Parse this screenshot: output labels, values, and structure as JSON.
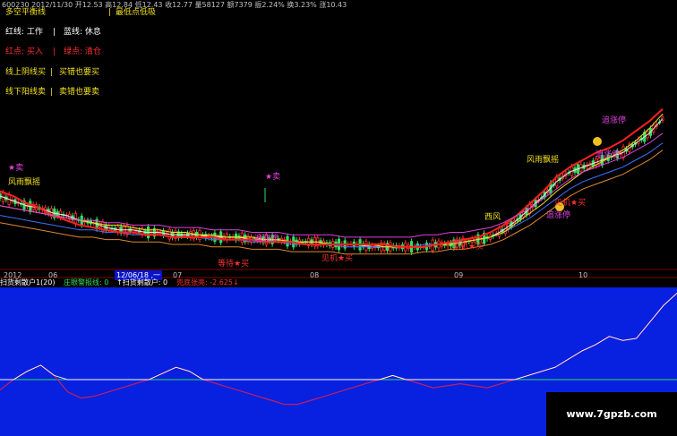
{
  "header": {
    "info_line": "600230  2012/11/30  开12.53  高12.84  低12.43  收12.77  量58127  额7379  振2.24%  换3.23%  涨10.43"
  },
  "top_legend": {
    "row0": [
      "多空平衡线",
      "|",
      "最低点低吸"
    ],
    "row1": [
      "红线: 工作",
      "|",
      "蓝线: 休息"
    ],
    "row2": [
      "红点: 买入",
      "|",
      "绿点: 清仓"
    ],
    "row3": [
      "线上阴线买",
      "|",
      "买错也要买"
    ],
    "row4": [
      "线下阳线卖",
      "|",
      "卖错也要卖"
    ]
  },
  "annotations": {
    "star_sell_1": "★卖",
    "storm_1": "风雨飘摇",
    "star_sell_2": "★卖",
    "chase_limit_1": "追涨停",
    "wait_buy_1": "等待★买",
    "buy_chance_1": "见机★买",
    "buy_chance_2": "见机★买",
    "west_wind": "西风",
    "storm_2": "风雨飘摇",
    "chase_limit_2": "追涨停",
    "chase_limit_3": "追涨停",
    "buy_chance_3": "见机★买",
    "chase_limit_4": "追涨停"
  },
  "time_axis": {
    "labels": [
      "2012",
      "06",
      "12/06/18 ,一",
      "07",
      "08",
      "09",
      "10"
    ]
  },
  "indicator_bar": {
    "title": "扫货剩散户1(20)",
    "line1": "庄眼警报线: 0",
    "line2": "↑扫货剩散户: 0",
    "line3": "兜底张亮: -2.625↓"
  },
  "watermark": "www.7gpzb.com",
  "colors": {
    "background": "#000000",
    "up_candle": "#ff3030",
    "down_candle": "#30e060",
    "ma_white": "#e8e8e8",
    "ma_yellow": "#f0e020",
    "ma_magenta": "#e040e0",
    "ma_red": "#ff2020",
    "ma_orange": "#e08830",
    "ma_blue": "#4070ff",
    "indicator_bg": "#0820e0",
    "indicator_line": "#c02060",
    "indicator_white": "#ffffff",
    "indicator_zero": "#30e060"
  },
  "chart_data": {
    "type": "line",
    "series": [
      {
        "values": [
          60,
          58,
          56,
          55,
          53,
          52,
          50,
          49,
          47,
          46,
          46,
          45,
          45,
          44,
          44,
          44,
          43,
          43,
          43,
          42,
          42,
          42,
          41,
          41,
          41,
          40,
          40,
          40,
          39,
          39,
          39,
          39,
          39,
          40,
          40,
          41,
          42,
          43,
          46,
          50,
          55,
          60,
          66,
          70,
          72,
          74,
          76,
          78,
          82,
          86,
          92
        ]
      },
      {
        "values": [
          52,
          51,
          50,
          49,
          48,
          47,
          46,
          46,
          45,
          45,
          44,
          44,
          44,
          43,
          43,
          43,
          42,
          42,
          42,
          41,
          41,
          41,
          40,
          40,
          40,
          40,
          39,
          39,
          39,
          39,
          39,
          39,
          40,
          40,
          41,
          41,
          42,
          43,
          45,
          48,
          51,
          55,
          59,
          63,
          66,
          68,
          70,
          72,
          75,
          78,
          82
        ]
      },
      {
        "values": [
          56,
          55,
          54,
          53,
          52,
          51,
          50,
          49,
          48,
          48,
          47,
          46,
          46,
          45,
          45,
          44,
          44,
          43,
          43,
          43,
          42,
          42,
          41,
          41,
          41,
          40,
          40,
          40,
          40,
          39,
          39,
          39,
          39,
          40,
          40,
          41,
          42,
          43,
          45,
          49,
          53,
          57,
          62,
          66,
          70,
          73,
          76,
          79,
          83,
          88,
          94
        ]
      },
      {
        "values": [
          62,
          60,
          57,
          55,
          52,
          50,
          48,
          47,
          46,
          45,
          45,
          44,
          44,
          43,
          43,
          43,
          43,
          42,
          42,
          42,
          41,
          41,
          41,
          40,
          40,
          40,
          40,
          40,
          40,
          40,
          39,
          39,
          39,
          40,
          41,
          42,
          43,
          45,
          48,
          52,
          57,
          62,
          68,
          72,
          75,
          78,
          80,
          83,
          87,
          91,
          96
        ]
      },
      {
        "values": [
          -5,
          0,
          4,
          7,
          2,
          -6,
          -9,
          -8,
          -6,
          -4,
          -2,
          0,
          3,
          6,
          4,
          0,
          -2,
          -4,
          -6,
          -8,
          -10,
          -12,
          -12,
          -10,
          -8,
          -6,
          -4,
          -2,
          0,
          2,
          0,
          -2,
          -4,
          -3,
          -2,
          -3,
          -4,
          -2,
          0,
          2,
          4,
          6,
          10,
          14,
          17,
          21,
          19,
          20,
          28,
          36,
          42
        ]
      }
    ]
  }
}
